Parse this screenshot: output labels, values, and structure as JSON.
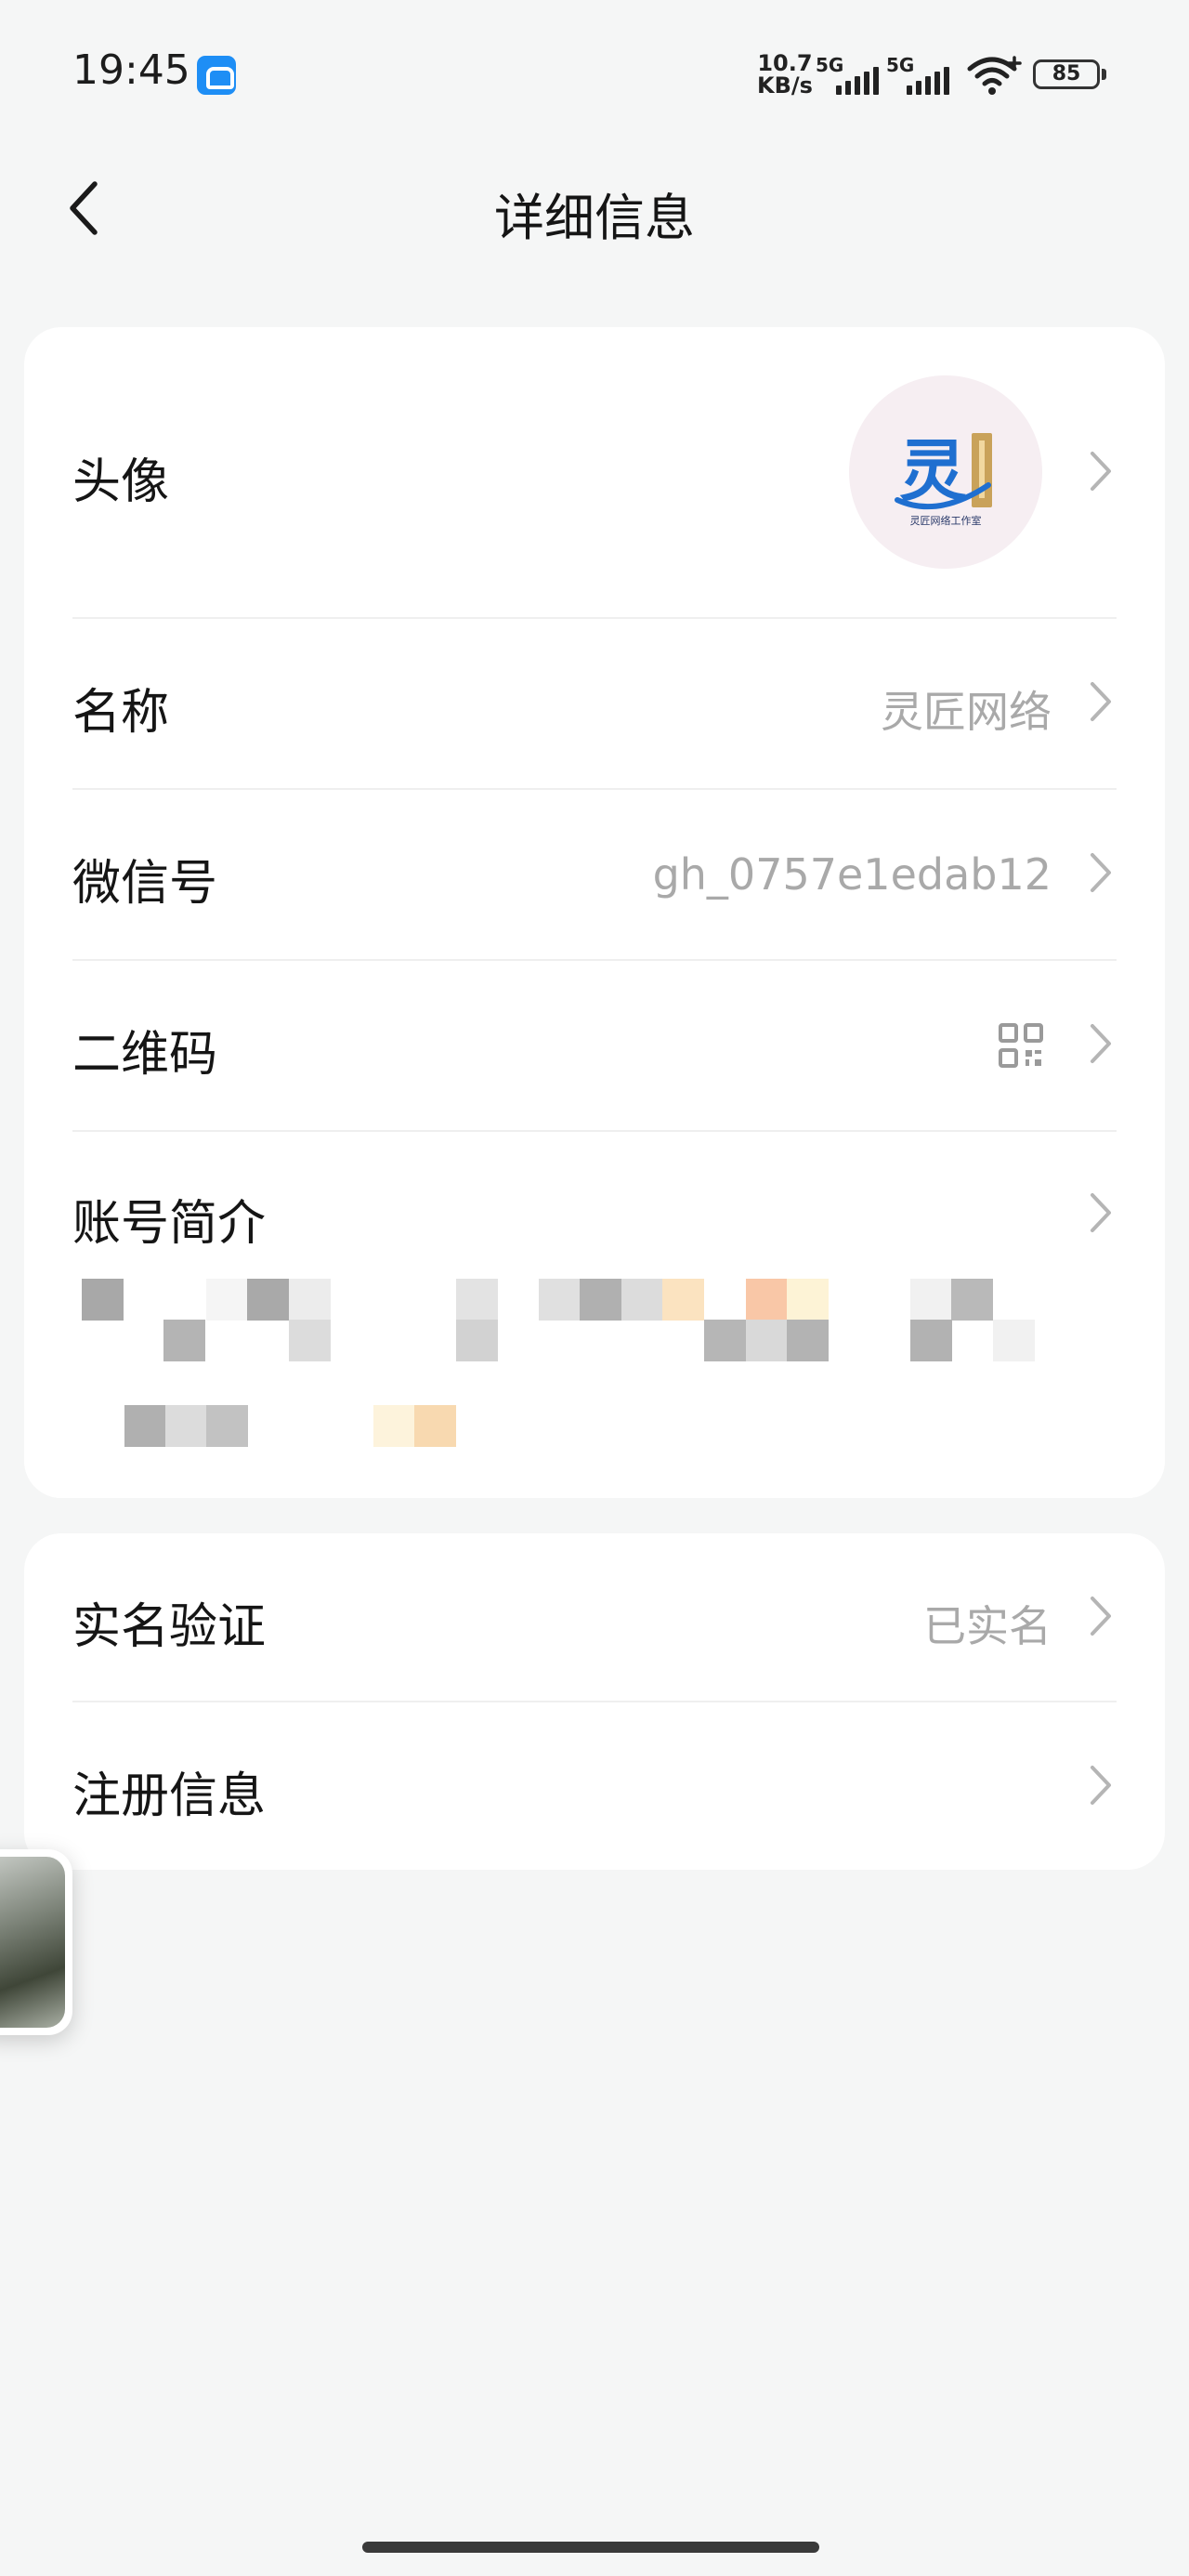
{
  "status_bar": {
    "time": "19:45",
    "net_speed_value": "10.7",
    "net_speed_unit": "KB/s",
    "sim1_tag": "5G",
    "sim2_tag": "5G",
    "battery_level": "85"
  },
  "nav": {
    "title": "详细信息",
    "back_icon": "chevron-left-icon"
  },
  "card1": {
    "avatar_label": "头像",
    "avatar_logo_text": "灵",
    "avatar_logo_caption": "灵匠网络工作室",
    "name_label": "名称",
    "name_value": "灵匠网络",
    "wechat_id_label": "微信号",
    "wechat_id_value": "gh_0757e1edab12",
    "qrcode_label": "二维码",
    "qrcode_icon": "qr-code-icon",
    "intro_label": "账号简介"
  },
  "card2": {
    "verify_label": "实名验证",
    "verify_value": "已实名",
    "register_label": "注册信息"
  },
  "colors": {
    "background": "#f5f6f6",
    "card": "#ffffff",
    "secondary_text": "#a9a9a9",
    "chevron": "#b5b5b5",
    "logo_blue": "#1f6fd0",
    "logo_gold": "#c9a25a"
  }
}
